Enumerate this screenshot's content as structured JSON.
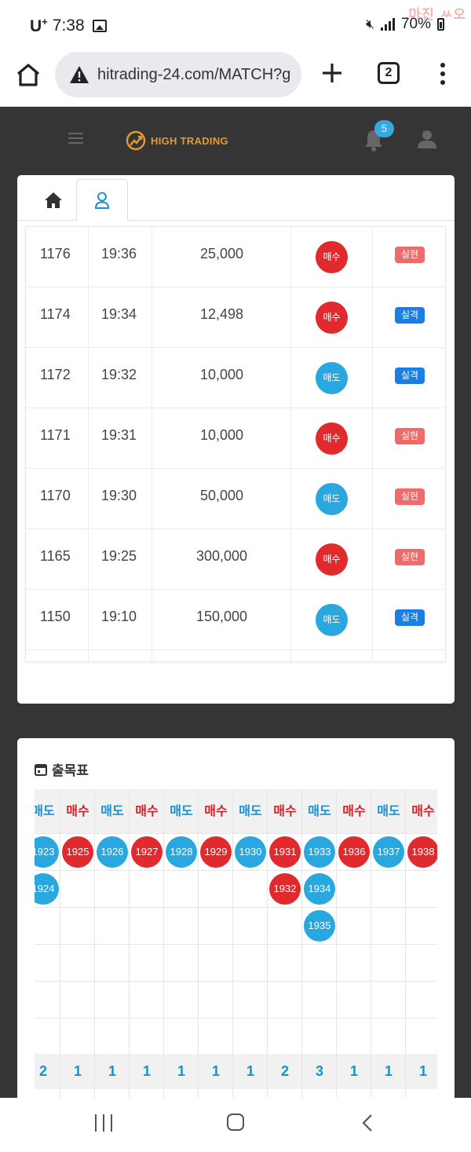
{
  "status_bar": {
    "carrier": "U",
    "carrier_sup": "+",
    "time": "7:38",
    "battery": "70%",
    "watermark": "마진 ㅆ오"
  },
  "browser": {
    "url": "hitrading-24.com/MATCH?g",
    "tab_count": "2"
  },
  "app": {
    "brand": "HIGH TRADING",
    "notification_count": "5",
    "colors": {
      "buy": "#e02a2e",
      "sell": "#29a8e0",
      "fail": "#ef6b6b",
      "lose": "#1a7fe0",
      "brand": "#e59b2b"
    }
  },
  "tabs": [
    {
      "icon": "home-icon"
    },
    {
      "icon": "user-icon",
      "active": true
    }
  ],
  "trades": [
    {
      "id": "1176",
      "time": "19:36",
      "amount": "25,000",
      "side": "매수",
      "side_type": "buy",
      "result": "실현",
      "result_type": "fail"
    },
    {
      "id": "1174",
      "time": "19:34",
      "amount": "12,498",
      "side": "매수",
      "side_type": "buy",
      "result": "실격",
      "result_type": "lose"
    },
    {
      "id": "1172",
      "time": "19:32",
      "amount": "10,000",
      "side": "매도",
      "side_type": "sell",
      "result": "실격",
      "result_type": "lose"
    },
    {
      "id": "1171",
      "time": "19:31",
      "amount": "10,000",
      "side": "매수",
      "side_type": "buy",
      "result": "실현",
      "result_type": "fail"
    },
    {
      "id": "1170",
      "time": "19:30",
      "amount": "50,000",
      "side": "매도",
      "side_type": "sell",
      "result": "실현",
      "result_type": "fail"
    },
    {
      "id": "1165",
      "time": "19:25",
      "amount": "300,000",
      "side": "매수",
      "side_type": "buy",
      "result": "실현",
      "result_type": "fail"
    },
    {
      "id": "1150",
      "time": "19:10",
      "amount": "150,000",
      "side": "매도",
      "side_type": "sell",
      "result": "실격",
      "result_type": "lose"
    }
  ],
  "schedule": {
    "title": "출목표",
    "columns": [
      {
        "label": "매도",
        "type": "sell",
        "balls": [
          "1923",
          "1924"
        ],
        "count": "2"
      },
      {
        "label": "매수",
        "type": "buy",
        "balls": [
          "1925"
        ],
        "count": "1"
      },
      {
        "label": "매도",
        "type": "sell",
        "balls": [
          "1926"
        ],
        "count": "1"
      },
      {
        "label": "매수",
        "type": "buy",
        "balls": [
          "1927"
        ],
        "count": "1"
      },
      {
        "label": "매도",
        "type": "sell",
        "balls": [
          "1928"
        ],
        "count": "1"
      },
      {
        "label": "매수",
        "type": "buy",
        "balls": [
          "1929"
        ],
        "count": "1"
      },
      {
        "label": "매도",
        "type": "sell",
        "balls": [
          "1930"
        ],
        "count": "1"
      },
      {
        "label": "매수",
        "type": "buy",
        "balls": [
          "1931",
          "1932"
        ],
        "count": "2"
      },
      {
        "label": "매도",
        "type": "sell",
        "balls": [
          "1933",
          "1934",
          "1935"
        ],
        "count": "3"
      },
      {
        "label": "매수",
        "type": "buy",
        "balls": [
          "1936"
        ],
        "count": "1"
      },
      {
        "label": "매도",
        "type": "sell",
        "balls": [
          "1937"
        ],
        "count": "1"
      },
      {
        "label": "매수",
        "type": "buy",
        "balls": [
          "1938"
        ],
        "count": "1"
      }
    ]
  }
}
